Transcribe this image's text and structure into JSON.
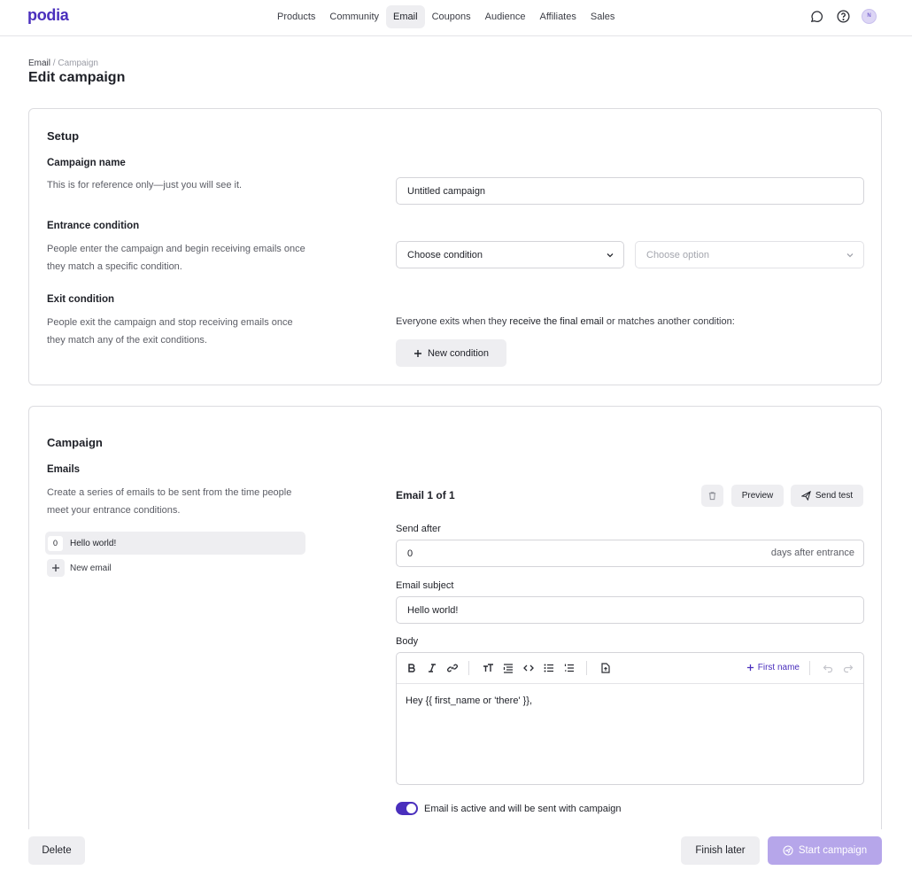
{
  "brand": {
    "name": "podia",
    "accent": "#4a2fbd"
  },
  "nav": {
    "items": [
      {
        "label": "Products"
      },
      {
        "label": "Community"
      },
      {
        "label": "Email",
        "active": true
      },
      {
        "label": "Coupons"
      },
      {
        "label": "Audience"
      },
      {
        "label": "Affiliates"
      },
      {
        "label": "Sales"
      }
    ],
    "icons": [
      "chat-bubble-icon",
      "help-circle-icon",
      "avatar"
    ],
    "avatar_initial": "N"
  },
  "breadcrumb": {
    "root": "Email",
    "separator": "/",
    "current": "Campaign"
  },
  "page_title": "Edit campaign",
  "setup": {
    "title": "Setup",
    "campaign_name": {
      "label": "Campaign name",
      "description": "This is for reference only—just you will see it.",
      "value": "Untitled campaign"
    },
    "entrance": {
      "label": "Entrance condition",
      "description": "People enter the campaign and begin receiving emails once they match a specific condition.",
      "condition_value": "Choose condition",
      "option_placeholder": "Choose option"
    },
    "exit": {
      "label": "Exit condition",
      "description": "People exit the campaign and stop receiving emails once they match any of the exit conditions.",
      "text_prefix": "Everyone exits when they",
      "text_emphasis": "receive the final email",
      "text_suffix": "or matches another condition:",
      "new_condition_label": "New condition"
    }
  },
  "campaign": {
    "title": "Campaign",
    "emails_label": "Emails",
    "emails_description": "Create a series of emails to be sent from the time people meet your entrance conditions.",
    "emails": [
      {
        "index": "0",
        "label": "Hello world!"
      }
    ],
    "new_email_label": "New email",
    "editor": {
      "heading": "Email 1 of 1",
      "preview_label": "Preview",
      "send_test_label": "Send test",
      "send_after_label": "Send after",
      "send_after_value": "0",
      "send_after_suffix": "days after entrance",
      "subject_label": "Email subject",
      "subject_value": "Hello world!",
      "body_label": "Body",
      "first_name_label": "First name",
      "body_text": "Hey {{ first_name or 'there' }},",
      "active_label": "Email is active and will be sent with campaign"
    }
  },
  "footer": {
    "delete_label": "Delete",
    "finish_later_label": "Finish later",
    "start_label": "Start campaign"
  }
}
